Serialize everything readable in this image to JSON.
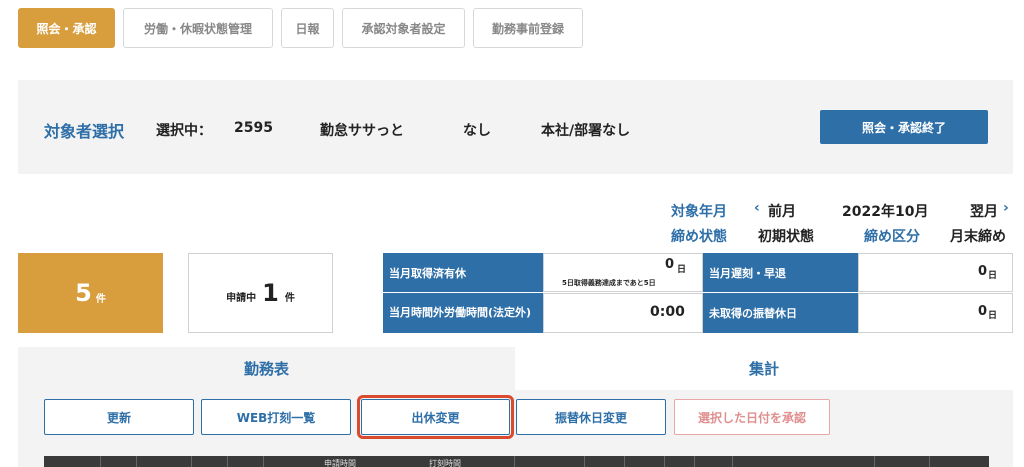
{
  "top_tabs": [
    {
      "label": "照会・承認",
      "active": true
    },
    {
      "label": "労働・休暇状態管理",
      "active": false
    },
    {
      "label": "日報",
      "active": false
    },
    {
      "label": "承認対象者設定",
      "active": false
    },
    {
      "label": "勤務事前登録",
      "active": false
    }
  ],
  "selection": {
    "title": "対象者選択",
    "selected_label": "選択中：",
    "employee_id": "2595",
    "employee_name": "勤怠ササっと",
    "role": "なし",
    "department": "本社/部署なし",
    "end_button": "照会・承認終了"
  },
  "period": {
    "target_label": "対象年月",
    "prev": "前月",
    "current": "2022年10月",
    "next": "翌月",
    "closing_state_label": "締め状態",
    "closing_state": "初期状態",
    "closing_type_label": "締め区分",
    "closing_type": "月末締め"
  },
  "counts": {
    "pending_number": "5",
    "pending_unit": "件",
    "applying_label": "申請中",
    "applying_number": "1",
    "applying_unit": "件"
  },
  "stats": {
    "leave_taken_label": "当月取得済有休",
    "leave_taken_value": "0",
    "leave_taken_unit": "日",
    "leave_note": "5日取得義務達成まであと5日",
    "late_label": "当月遅刻・早退",
    "late_value": "0",
    "late_unit": "日",
    "overtime_label": "当月時間外労働時間(法定外)",
    "overtime_value": "0:00",
    "untaken_label": "未取得の振替休日",
    "untaken_value": "0",
    "untaken_unit": "日"
  },
  "sub_tabs": [
    {
      "label": "勤務表",
      "active": false
    },
    {
      "label": "集計",
      "active": true
    }
  ],
  "actions": {
    "refresh": "更新",
    "web_punch": "WEB打刻一覧",
    "change_attendance": "出休変更",
    "substitute_change": "振替休日変更",
    "approve_selected": "選択した日付を承認"
  },
  "table_headers": {
    "application_time": "申請時間",
    "punch_time": "打刻時間"
  },
  "colors": {
    "accent_orange": "#d89e3e",
    "primary_blue": "#2f6fa8",
    "highlight_red": "#d94a2e"
  }
}
